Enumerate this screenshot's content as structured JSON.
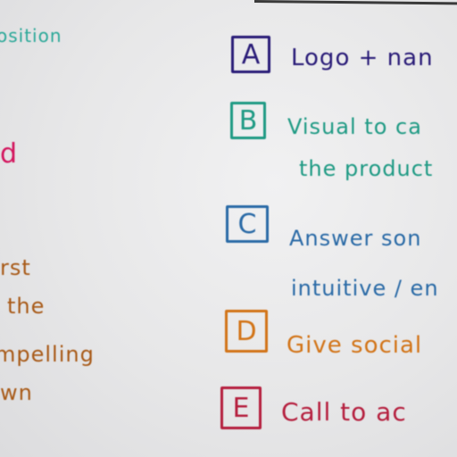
{
  "left_column": {
    "line1": "osition",
    "line2": "d",
    "line3": "rst",
    "line4": "the",
    "line5": "mpelling",
    "line6": "wn"
  },
  "items": [
    {
      "letter": "A",
      "text": "Logo + nan"
    },
    {
      "letter": "B",
      "text": "Visual to ca"
    },
    {
      "letter": "",
      "text": "the product"
    },
    {
      "letter": "C",
      "text": "Answer son"
    },
    {
      "letter": "",
      "text": "intuitive / en"
    },
    {
      "letter": "D",
      "text": "Give social"
    },
    {
      "letter": "E",
      "text": "Call to ac"
    }
  ]
}
